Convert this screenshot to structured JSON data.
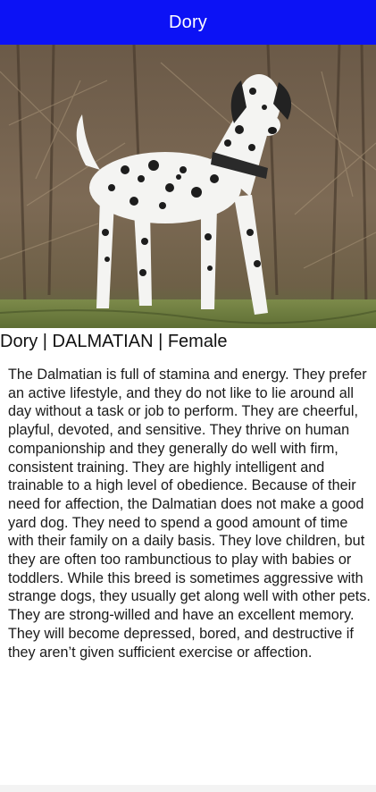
{
  "app_bar": {
    "title": "Dory",
    "color": "#0c12f5"
  },
  "hero_image": {
    "subject": "dalmatian-photo"
  },
  "info_line": "Dory | DALMATIAN | Female",
  "description": "The Dalmatian is full of stamina and energy. They prefer an active lifestyle, and they do not like to lie around all day without a task or job to perform. They are cheerful, playful, devoted, and sensitive. They thrive on human companionship and they generally do well with firm, consistent training. They are highly intelligent and trainable to a high level of obedience. Because of their need for affection, the Dalmatian does not make a good yard dog. They need to spend a good amount of time with their family on a daily basis. They love children, but they are often too rambunctious to play with babies or toddlers. While this breed is sometimes aggressive with strange dogs, they usually get along well with other pets. They are strong-willed and have an excellent memory. They will become depressed, bored, and destructive if they aren’t given sufficient exercise or affection."
}
